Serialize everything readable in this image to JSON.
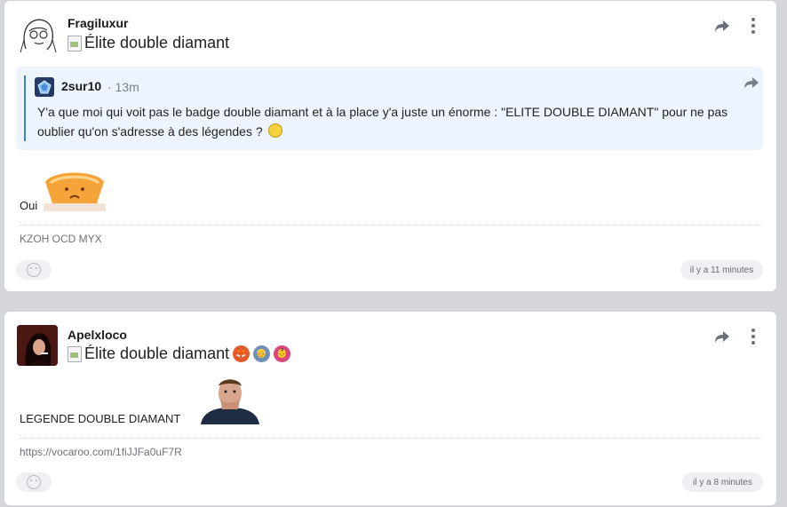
{
  "posts": [
    {
      "author": "Fragiluxur",
      "badge_alt": "Élite double diamant",
      "quote": {
        "author": "2sur10",
        "time": "· 13m",
        "text": "Y'a que moi qui voit pas le badge double diamant et à la place y'a juste un énorme : \"ELITE DOUBLE DIAMANT\" pour ne pas oublier qu'on s'adresse à des légendes ?"
      },
      "body": "Oui",
      "signature": "KZOH OCD MYX",
      "timestamp": "il y a 11 minutes"
    },
    {
      "author": "Apelxloco",
      "badge_alt": "Élite double diamant",
      "body": "LEGENDE DOUBLE DIAMANT",
      "signature": "https://vocaroo.com/1fiJJFa0uF7R",
      "timestamp": "il y a 8 minutes"
    }
  ],
  "icons": {
    "share": "share-arrow-icon",
    "more": "vertical-dots-icon",
    "reaction": "add-reaction-icon"
  },
  "colors": {
    "quote_bg": "#eef4fd",
    "quote_bar": "#3d7fe0",
    "page_bg": "#d4d6db"
  }
}
